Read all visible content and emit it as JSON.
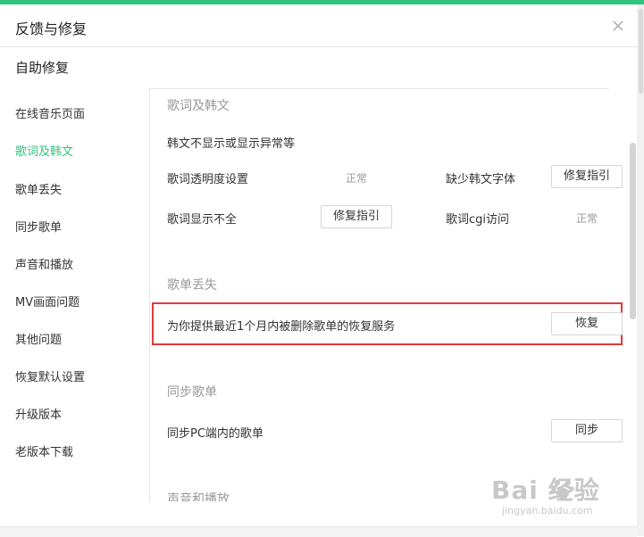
{
  "window": {
    "title": "反馈与修复"
  },
  "page": {
    "section_title": "自助修复"
  },
  "sidebar": {
    "items": [
      {
        "label": "在线音乐页面",
        "active": false
      },
      {
        "label": "歌词及韩文",
        "active": true
      },
      {
        "label": "歌单丢失",
        "active": false
      },
      {
        "label": "同步歌单",
        "active": false
      },
      {
        "label": "声音和播放",
        "active": false
      },
      {
        "label": "MV画面问题",
        "active": false
      },
      {
        "label": "其他问题",
        "active": false
      },
      {
        "label": "恢复默认设置",
        "active": false
      },
      {
        "label": "升级版本",
        "active": false
      },
      {
        "label": "老版本下载",
        "active": false
      }
    ]
  },
  "main": {
    "lyrics": {
      "title": "歌词及韩文",
      "korean_issue": "韩文不显示或显示异常等",
      "transparency_label": "歌词透明度设置",
      "transparency_status": "正常",
      "missing_font_label": "缺少韩文字体",
      "missing_font_button": "修复指引",
      "incomplete_label": "歌词显示不全",
      "incomplete_button": "修复指引",
      "cgi_label": "歌词cgi访问",
      "cgi_status": "正常"
    },
    "playlist_loss": {
      "title": "歌单丢失",
      "restore_text": "为你提供最近1个月内被删除歌单的恢复服务",
      "restore_button": "恢复"
    },
    "sync": {
      "title": "同步歌单",
      "sync_text": "同步PC端内的歌单",
      "sync_button": "同步"
    },
    "sound": {
      "title": "声音和播放"
    }
  },
  "watermark": {
    "logo": "Bai  经验",
    "sub": "jingyan.baidu.com"
  },
  "colors": {
    "accent": "#31c27c",
    "highlight": "#e03a3a"
  }
}
